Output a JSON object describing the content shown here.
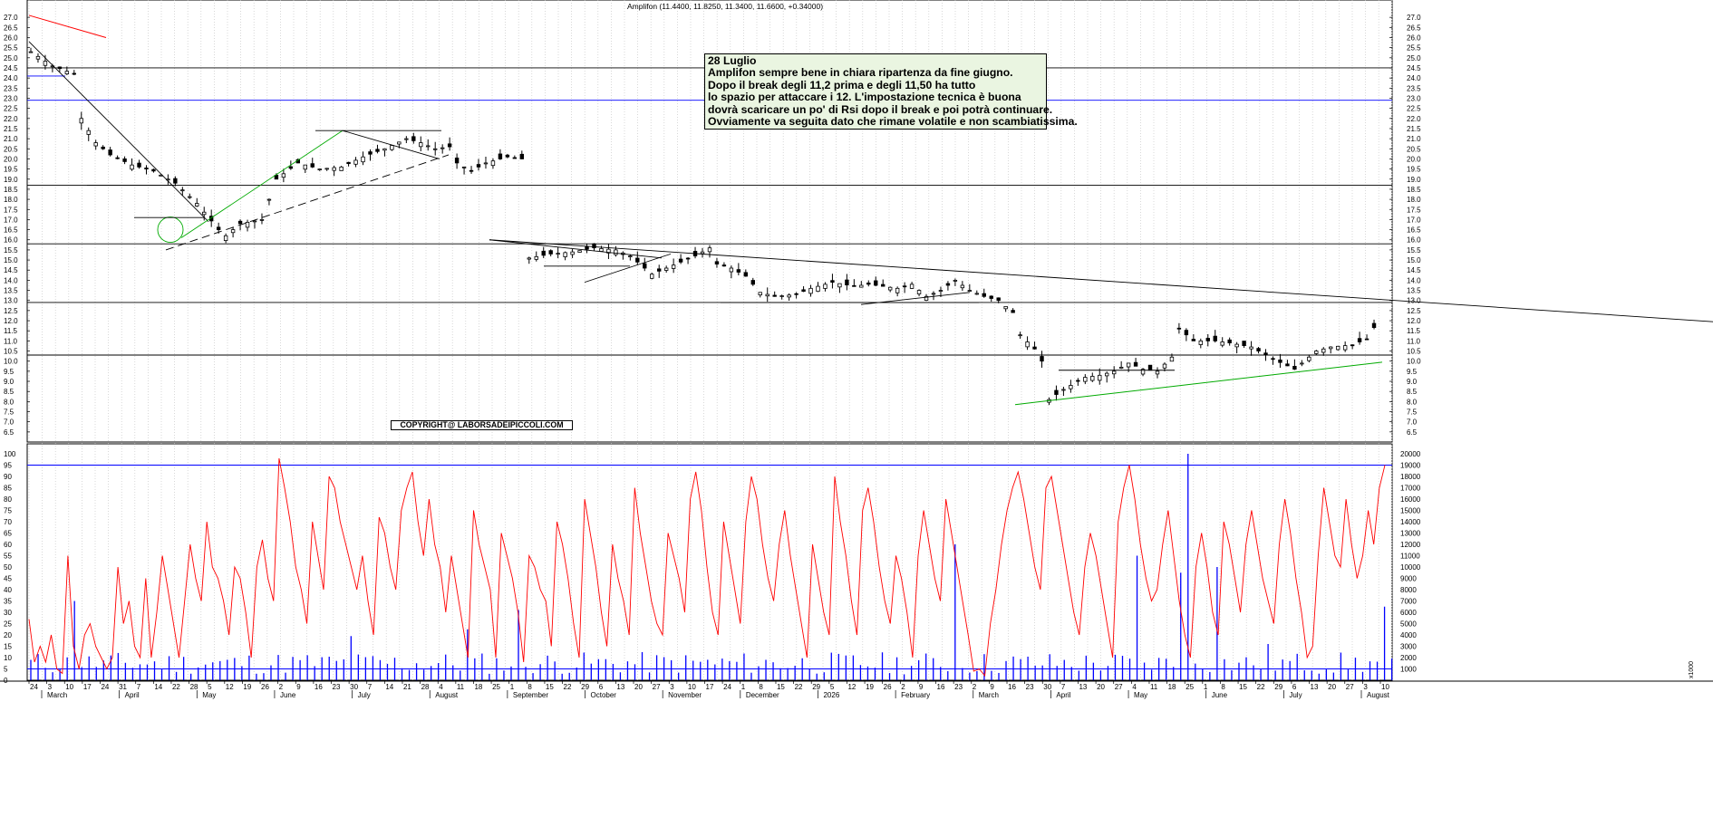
{
  "chart_data": [
    {
      "type": "candlestick",
      "title": "Amplifon (11.4400, 11.8250, 11.3400, 11.6600, +0.34000)",
      "ylim": [
        6.0,
        27.5
      ],
      "yticks": [
        6.5,
        7.0,
        7.5,
        8.0,
        8.5,
        9.0,
        9.5,
        10.0,
        10.5,
        11.0,
        11.5,
        12.0,
        12.5,
        13.0,
        13.5,
        14.0,
        14.5,
        15.0,
        15.5,
        16.0,
        16.5,
        17.0,
        17.5,
        18.0,
        18.5,
        19.0,
        19.5,
        20.0,
        20.5,
        21.0,
        21.5,
        22.0,
        22.5,
        23.0,
        23.5,
        24.0,
        24.5,
        25.0,
        25.5,
        26.0,
        26.5,
        27.0
      ],
      "ytick_labels": [
        "6.5",
        "7.0",
        "7.5",
        "8.0",
        "8.5",
        "9.0",
        "9.5",
        "10.0",
        "10.5",
        "11.0",
        "11.5",
        "12.0",
        "12.5",
        "13.0",
        "13.5",
        "14.0",
        "14.5",
        "15.0",
        "15.5",
        "16.0",
        "16.5",
        "17.0",
        "17.5",
        "18.0",
        "18.5",
        "19.0",
        "19.5",
        "20.0",
        "20.5",
        "21.0",
        "21.5",
        "22.0",
        "22.5",
        "23.0",
        "23.5",
        "24.0",
        "24.5",
        "25.0",
        "25.5",
        "26.0",
        "26.5",
        "27.0"
      ],
      "grid": true,
      "last": {
        "open": 11.44,
        "high": 11.825,
        "low": 11.34,
        "close": 11.66
      },
      "price_path": [
        [
          0,
          25.3
        ],
        [
          3,
          24.6
        ],
        [
          6,
          24.2
        ],
        [
          7,
          22.0
        ],
        [
          9,
          20.8
        ],
        [
          11,
          20.2
        ],
        [
          14,
          19.7
        ],
        [
          17,
          19.4
        ],
        [
          20,
          18.8
        ],
        [
          23,
          17.8
        ],
        [
          26,
          16.5
        ],
        [
          27,
          16.2
        ],
        [
          29,
          16.8
        ],
        [
          32,
          17.0
        ],
        [
          34,
          19.0
        ],
        [
          37,
          19.8
        ],
        [
          40,
          19.5
        ],
        [
          43,
          19.6
        ],
        [
          46,
          20.1
        ],
        [
          49,
          20.5
        ],
        [
          52,
          21.0
        ],
        [
          54,
          20.8
        ],
        [
          56,
          20.5
        ],
        [
          58,
          20.6
        ],
        [
          59,
          19.8
        ],
        [
          61,
          19.4
        ],
        [
          63,
          19.8
        ],
        [
          66,
          20.1
        ],
        [
          68,
          20.0
        ],
        [
          69,
          15.1
        ],
        [
          72,
          15.3
        ],
        [
          75,
          15.4
        ],
        [
          78,
          15.6
        ],
        [
          81,
          15.5
        ],
        [
          83,
          15.2
        ],
        [
          86,
          14.3
        ],
        [
          88,
          14.6
        ],
        [
          90,
          14.9
        ],
        [
          92,
          15.2
        ],
        [
          94,
          15.6
        ],
        [
          95,
          14.8
        ],
        [
          97,
          14.6
        ],
        [
          99,
          14.2
        ],
        [
          101,
          13.4
        ],
        [
          103,
          13.2
        ],
        [
          106,
          13.3
        ],
        [
          108,
          13.6
        ],
        [
          111,
          13.9
        ],
        [
          114,
          13.7
        ],
        [
          116,
          13.8
        ],
        [
          118,
          13.7
        ],
        [
          120,
          13.6
        ],
        [
          122,
          13.8
        ],
        [
          124,
          13.2
        ],
        [
          126,
          13.5
        ],
        [
          128,
          14.0
        ],
        [
          130,
          13.5
        ],
        [
          132,
          13.2
        ],
        [
          134,
          13.0
        ],
        [
          136,
          12.4
        ],
        [
          137,
          11.3
        ],
        [
          139,
          10.6
        ],
        [
          140,
          10.0
        ],
        [
          141,
          8.1
        ],
        [
          143,
          8.6
        ],
        [
          146,
          9.2
        ],
        [
          148,
          9.3
        ],
        [
          150,
          9.5
        ],
        [
          152,
          9.9
        ],
        [
          154,
          9.6
        ],
        [
          156,
          9.5
        ],
        [
          158,
          10.2
        ],
        [
          159,
          11.6
        ],
        [
          161,
          11.0
        ],
        [
          164,
          11.0
        ],
        [
          166,
          10.9
        ],
        [
          169,
          10.7
        ],
        [
          172,
          10.1
        ],
        [
          175,
          9.6
        ],
        [
          176,
          9.9
        ],
        [
          178,
          10.5
        ],
        [
          180,
          10.7
        ],
        [
          183,
          10.8
        ],
        [
          185,
          11.1
        ],
        [
          186,
          11.66
        ]
      ],
      "month_labels": [
        "March",
        "April",
        "May",
        "June",
        "July",
        "August",
        "September",
        "October",
        "November",
        "December",
        "2026",
        "February",
        "March",
        "April",
        "May",
        "June",
        "July",
        "August"
      ],
      "day_labels": [
        "24",
        "3",
        "10",
        "17",
        "24",
        "31",
        "7",
        "14",
        "22",
        "28",
        "5",
        "12",
        "19",
        "26",
        "2",
        "9",
        "16",
        "23",
        "30",
        "7",
        "14",
        "21",
        "28",
        "4",
        "11",
        "18",
        "25",
        "1",
        "8",
        "15",
        "22",
        "29",
        "6",
        "13",
        "20",
        "27",
        "3",
        "10",
        "17",
        "24",
        "1",
        "8",
        "15",
        "22",
        "29",
        "5",
        "12",
        "19",
        "26",
        "2",
        "9",
        "16",
        "23",
        "2",
        "9",
        "16",
        "23",
        "30",
        "7",
        "13",
        "20",
        "27",
        "4",
        "11",
        "18",
        "25",
        "1",
        "8",
        "15",
        "22",
        "29",
        "6",
        "13",
        "20",
        "27",
        "3",
        "10"
      ],
      "annotations": [
        "28 Luglio",
        "Amplifon sempre bene in chiara ripartenza  da fine giugno.",
        "Dopo il break degli 11,2 prima e degli 11,50 ha tutto",
        "lo spazio per attaccare i 12. L'impostazione tecnica è buona",
        "dovrà scaricare un po' di Rsi dopo il break e poi potrà continuare.",
        "Ovviamente va seguita dato che rimane volatile e non scambiatissima."
      ]
    },
    {
      "type": "line",
      "series": [
        {
          "values": [
            27,
            8,
            15,
            8,
            20,
            5,
            3,
            55,
            15,
            5,
            20,
            25,
            15,
            10,
            5,
            10,
            50,
            25,
            35,
            15,
            10,
            45,
            10,
            30,
            55,
            40,
            25,
            10,
            35,
            60,
            45,
            35,
            70,
            50,
            45,
            35,
            20,
            50,
            45,
            30,
            10,
            50,
            62,
            45,
            35,
            98,
            85,
            70,
            50,
            40,
            25,
            70,
            55,
            40,
            90,
            85,
            70,
            60,
            50,
            40,
            55,
            35,
            20,
            72,
            65,
            50,
            40,
            75,
            85,
            92,
            70,
            55,
            80,
            60,
            50,
            30,
            55,
            40,
            25,
            10,
            75,
            60,
            50,
            40,
            10,
            65,
            55,
            45,
            30,
            8,
            55,
            50,
            40,
            35,
            15,
            70,
            60,
            45,
            25,
            10,
            80,
            65,
            50,
            30,
            15,
            60,
            45,
            35,
            20,
            85,
            65,
            50,
            35,
            25,
            20,
            65,
            55,
            45,
            30,
            80,
            92,
            75,
            50,
            30,
            20,
            70,
            55,
            40,
            25,
            70,
            90,
            80,
            60,
            45,
            35,
            60,
            75,
            55,
            40,
            25,
            10,
            60,
            45,
            30,
            20,
            90,
            70,
            55,
            35,
            20,
            75,
            85,
            70,
            50,
            35,
            25,
            55,
            45,
            30,
            10,
            55,
            75,
            60,
            45,
            35,
            80,
            65,
            50,
            35,
            20,
            4,
            5,
            2,
            25,
            40,
            60,
            75,
            85,
            92,
            80,
            65,
            50,
            40,
            85,
            90,
            75,
            60,
            45,
            30,
            20,
            50,
            65,
            55,
            40,
            25,
            10,
            70,
            85,
            95,
            80,
            60,
            45,
            35,
            40,
            60,
            75,
            55,
            35,
            20,
            10,
            50,
            65,
            50,
            30,
            20,
            70,
            60,
            45,
            30,
            60,
            75,
            60,
            45,
            35,
            25,
            60,
            80,
            65,
            45,
            30,
            10,
            15,
            55,
            85,
            70,
            55,
            50,
            80,
            60,
            45,
            55,
            75,
            60,
            85,
            95
          ]
        }
      ],
      "color": "#ff0000",
      "ylim": [
        0,
        100
      ],
      "yticks": [
        0,
        5,
        10,
        15,
        20,
        25,
        30,
        35,
        40,
        45,
        50,
        55,
        60,
        65,
        70,
        75,
        80,
        85,
        90,
        95,
        100
      ],
      "ytick_labels": [
        "0",
        "5",
        "10",
        "15",
        "20",
        "25",
        "30",
        "35",
        "40",
        "45",
        "50",
        "55",
        "60",
        "65",
        "70",
        "75",
        "80",
        "85",
        "90",
        "95",
        "100"
      ]
    },
    {
      "type": "bar",
      "color": "#0000ff",
      "ylim": [
        0,
        20000
      ],
      "yticks": [
        1000,
        2000,
        3000,
        4000,
        5000,
        6000,
        7000,
        8000,
        9000,
        10000,
        11000,
        12000,
        13000,
        14000,
        15000,
        16000,
        17000,
        18000,
        19000,
        20000
      ],
      "ytick_labels": [
        "1000",
        "2000",
        "3000",
        "4000",
        "5000",
        "6000",
        "7000",
        "8000",
        "9000",
        "10000",
        "11000",
        "12000",
        "13000",
        "14000",
        "15000",
        "16000",
        "17000",
        "18000",
        "19000",
        "20000"
      ],
      "axis_unit": "x1000"
    }
  ],
  "note": {
    "title": "28 Luglio",
    "lines": [
      "Amplifon sempre bene in chiara ripartenza  da fine giugno.",
      "Dopo il break degli 11,2 prima e degli 11,50 ha tutto",
      "lo spazio per attaccare i 12. L'impostazione tecnica è buona",
      "dovrà scaricare un po' di Rsi dopo il break e poi potrà continuare.",
      "Ovviamente va seguita dato che rimane volatile e non scambiatissima."
    ]
  },
  "copyright": "COPYRIGHT@ LABORSADEIPICCOLI.COM",
  "colors": {
    "candles": "#000000",
    "rsi": "#ff0000",
    "volume": "#0000ff",
    "support": "#0000ff",
    "trend_green": "#00aa00",
    "trend_red": "#ff0000"
  }
}
